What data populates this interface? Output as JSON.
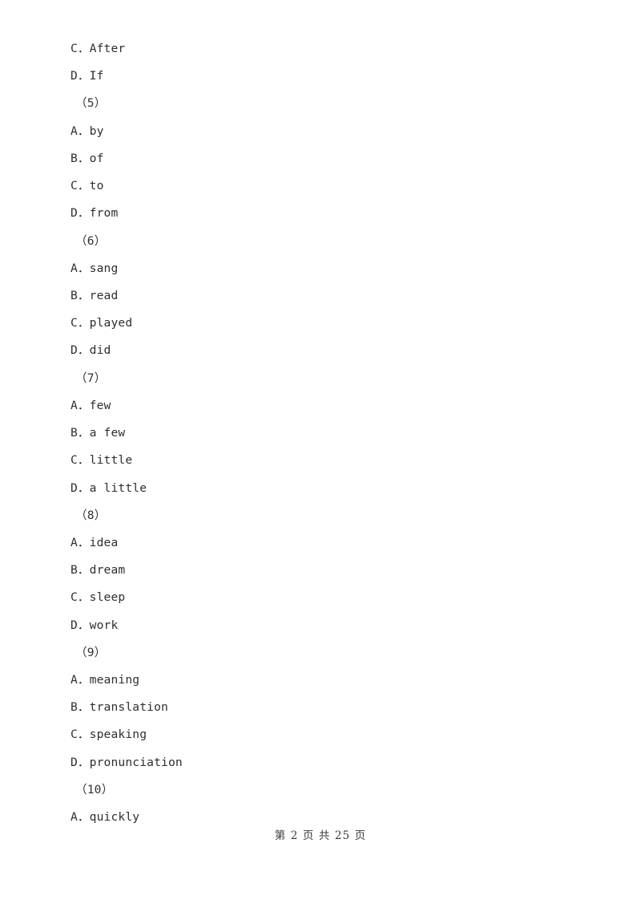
{
  "document": {
    "page_background": "#ffffff",
    "text_color": "#2e2e2e",
    "lines": [
      {
        "id": "line-1",
        "kind": "option",
        "text": "C．After"
      },
      {
        "id": "line-2",
        "kind": "option",
        "text": "D．If"
      },
      {
        "id": "line-3",
        "kind": "q-number",
        "text": "（5）"
      },
      {
        "id": "line-4",
        "kind": "option",
        "text": "A．by"
      },
      {
        "id": "line-5",
        "kind": "option",
        "text": "B．of"
      },
      {
        "id": "line-6",
        "kind": "option",
        "text": "C．to"
      },
      {
        "id": "line-7",
        "kind": "option",
        "text": "D．from"
      },
      {
        "id": "line-8",
        "kind": "q-number",
        "text": "（6）"
      },
      {
        "id": "line-9",
        "kind": "option",
        "text": "A．sang"
      },
      {
        "id": "line-10",
        "kind": "option",
        "text": "B．read"
      },
      {
        "id": "line-11",
        "kind": "option",
        "text": "C．played"
      },
      {
        "id": "line-12",
        "kind": "option",
        "text": "D．did"
      },
      {
        "id": "line-13",
        "kind": "q-number",
        "text": "（7）"
      },
      {
        "id": "line-14",
        "kind": "option",
        "text": "A．few"
      },
      {
        "id": "line-15",
        "kind": "option",
        "text": "B．a few"
      },
      {
        "id": "line-16",
        "kind": "option",
        "text": "C．little"
      },
      {
        "id": "line-17",
        "kind": "option",
        "text": "D．a little"
      },
      {
        "id": "line-18",
        "kind": "q-number",
        "text": "（8）"
      },
      {
        "id": "line-19",
        "kind": "option",
        "text": "A．idea"
      },
      {
        "id": "line-20",
        "kind": "option",
        "text": "B．dream"
      },
      {
        "id": "line-21",
        "kind": "option",
        "text": "C．sleep"
      },
      {
        "id": "line-22",
        "kind": "option",
        "text": "D．work"
      },
      {
        "id": "line-23",
        "kind": "q-number",
        "text": "（9）"
      },
      {
        "id": "line-24",
        "kind": "option",
        "text": "A．meaning"
      },
      {
        "id": "line-25",
        "kind": "option",
        "text": "B．translation"
      },
      {
        "id": "line-26",
        "kind": "option",
        "text": "C．speaking"
      },
      {
        "id": "line-27",
        "kind": "option",
        "text": "D．pronunciation"
      },
      {
        "id": "line-28",
        "kind": "q-number",
        "text": "（10）"
      },
      {
        "id": "line-29",
        "kind": "option",
        "text": "A．quickly"
      }
    ]
  },
  "footer": {
    "text": "第 2 页 共 25 页",
    "current_page": "2",
    "total_pages": "25"
  }
}
